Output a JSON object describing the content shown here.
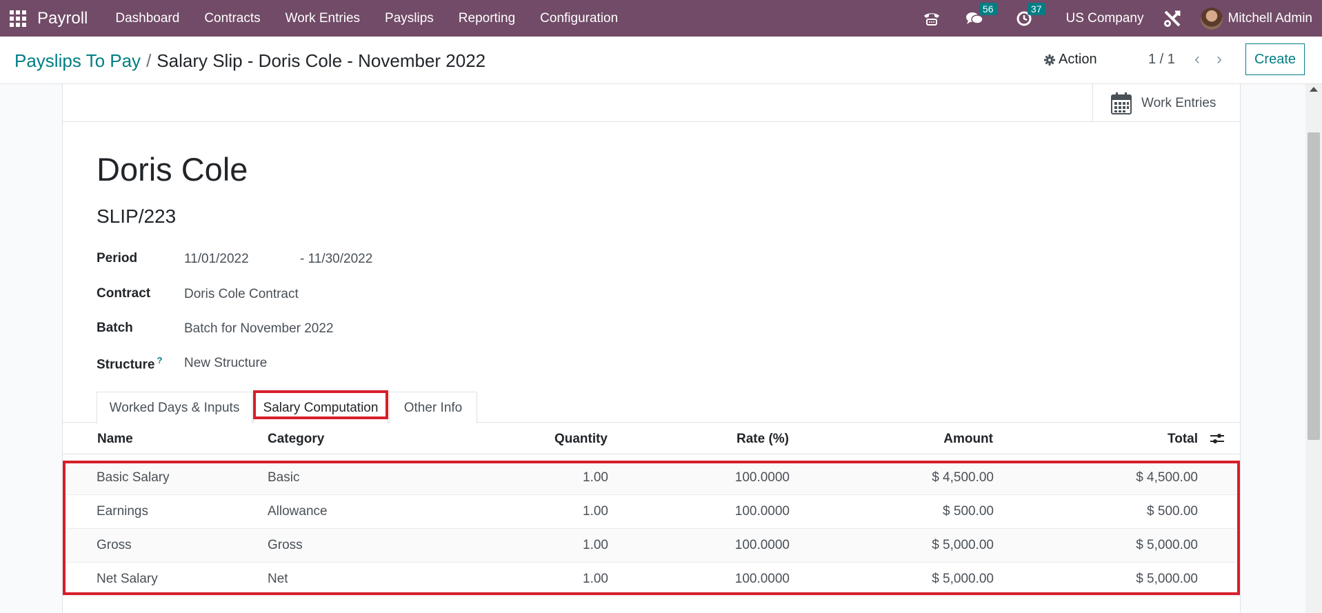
{
  "navbar": {
    "brand": "Payroll",
    "menu": [
      "Dashboard",
      "Contracts",
      "Work Entries",
      "Payslips",
      "Reporting",
      "Configuration"
    ],
    "messages_count": "56",
    "activities_count": "37",
    "company": "US Company",
    "user": "Mitchell Admin",
    "bg_color": "#714b67"
  },
  "control": {
    "breadcrumb_parent": "Payslips To Pay",
    "breadcrumb_separator": "/",
    "breadcrumb_current": "Salary Slip - Doris Cole - November 2022",
    "action_label": "Action",
    "pager": "1 / 1",
    "create_label": "Create"
  },
  "smart_button": {
    "label": "Work Entries"
  },
  "form": {
    "employee_name": "Doris Cole",
    "slip_number": "SLIP/223",
    "period_label": "Period",
    "period_from": "11/01/2022",
    "period_to": "- 11/30/2022",
    "contract_label": "Contract",
    "contract_value": "Doris Cole Contract",
    "batch_label": "Batch",
    "batch_value": "Batch for November 2022",
    "structure_label": "Structure",
    "structure_help": "?",
    "structure_value": "New Structure"
  },
  "tabs": [
    "Worked Days & Inputs",
    "Salary Computation",
    "Other Info"
  ],
  "active_tab": "Salary Computation",
  "table": {
    "headers": [
      "Name",
      "Category",
      "Quantity",
      "Rate (%)",
      "Amount",
      "Total"
    ],
    "rows": [
      [
        "Basic Salary",
        "Basic",
        "1.00",
        "100.0000",
        "$ 4,500.00",
        "$ 4,500.00"
      ],
      [
        "Earnings",
        "Allowance",
        "1.00",
        "100.0000",
        "$ 500.00",
        "$ 500.00"
      ],
      [
        "Gross",
        "Gross",
        "1.00",
        "100.0000",
        "$ 5,000.00",
        "$ 5,000.00"
      ],
      [
        "Net Salary",
        "Net",
        "1.00",
        "100.0000",
        "$ 5,000.00",
        "$ 5,000.00"
      ]
    ]
  },
  "colors": {
    "accent": "#017e84",
    "highlight": "#d71f2b"
  }
}
